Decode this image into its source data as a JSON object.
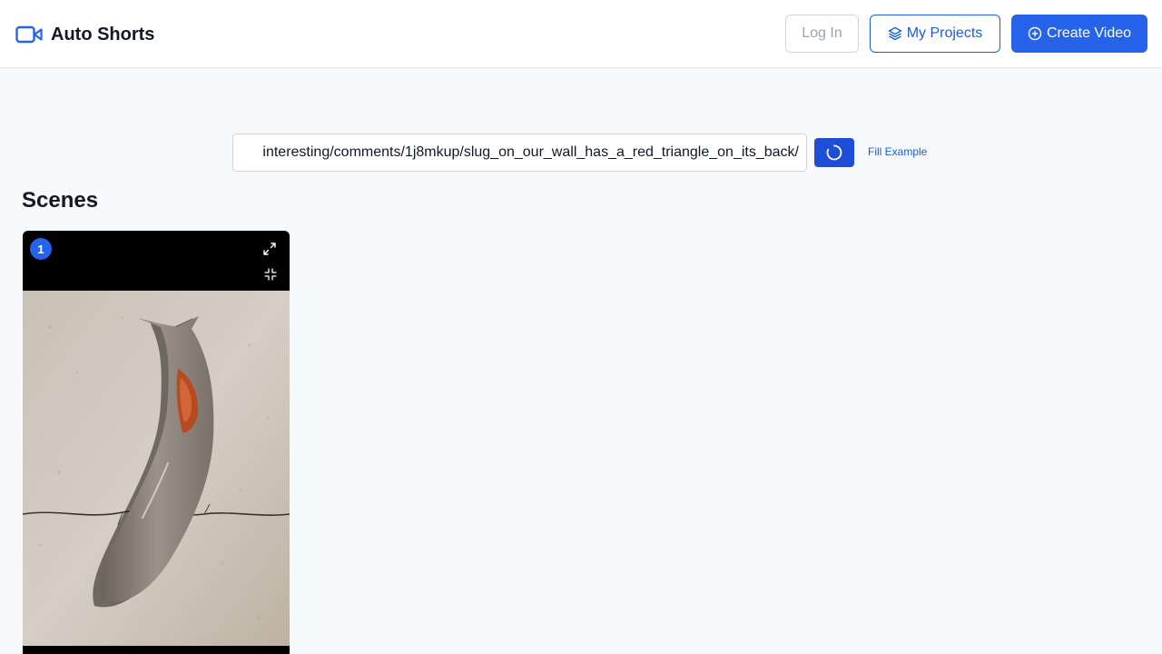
{
  "header": {
    "brand_name": "Auto Shorts",
    "brand_icon": "video-camera-icon",
    "login_label": "Log In",
    "projects_label": "My Projects",
    "create_label": "Create Video"
  },
  "form": {
    "url_value": "interesting/comments/1j8mkup/slug_on_our_wall_has_a_red_triangle_on_its_back/",
    "refresh_icon": "loading-spinner-icon",
    "fill_example_label": "Fill Example"
  },
  "scenes": {
    "title": "Scenes",
    "items": [
      {
        "number": "1",
        "image": "slug-on-wall-photo"
      }
    ]
  },
  "colors": {
    "accent": "#2563eb",
    "accent_dark": "#1d4ed8",
    "page_bg": "#f8f9fb"
  }
}
